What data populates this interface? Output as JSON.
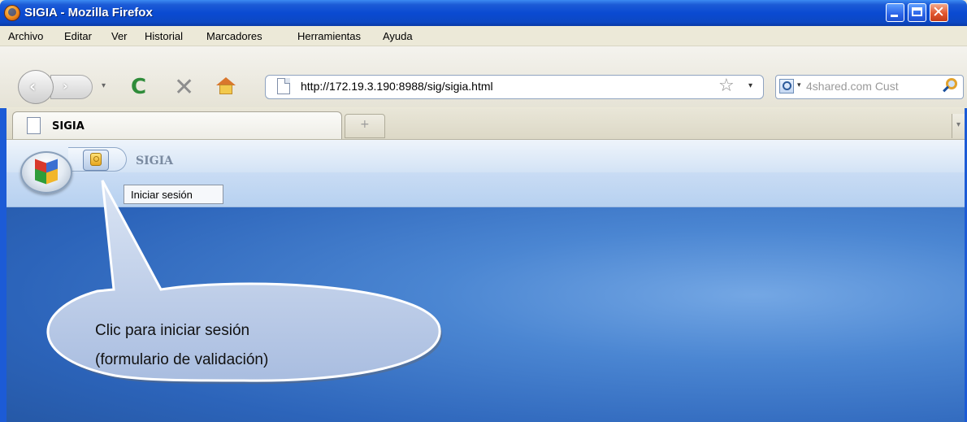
{
  "window": {
    "title": "SIGIA - Mozilla Firefox",
    "controls": {
      "minimize": "",
      "maximize": "",
      "close": "✕"
    }
  },
  "menu": {
    "items": [
      {
        "label": "Archivo"
      },
      {
        "label": "Editar"
      },
      {
        "label": "Ver"
      },
      {
        "label": "Historial"
      },
      {
        "label": "Marcadores"
      },
      {
        "label": "Herramientas"
      },
      {
        "label": "Ayuda"
      }
    ]
  },
  "toolbar": {
    "back_glyph": "‹",
    "forward_glyph": "›",
    "dropdown_glyph": "▾",
    "reload_glyph": "C",
    "stop_glyph": "✕",
    "url": "http://172.19.3.190:8988/sig/sigia.html",
    "bookmark_glyph": "☆",
    "search_placeholder": "4shared.com Cust"
  },
  "tabs": {
    "items": [
      {
        "label": "SIGIA"
      }
    ],
    "new_tab_glyph": "+",
    "scroll_glyph": "▾"
  },
  "app": {
    "title": "SIGIA",
    "tooltip": "Iniciar sesión"
  },
  "callout": {
    "line1": "Clic para iniciar sesión",
    "line2": "(formulario de validación)"
  },
  "colors": {
    "xp_titlebar": "#0a4ad2",
    "desktop_blue": "#2c64ba",
    "callout_fill": "#b4c6e7"
  }
}
